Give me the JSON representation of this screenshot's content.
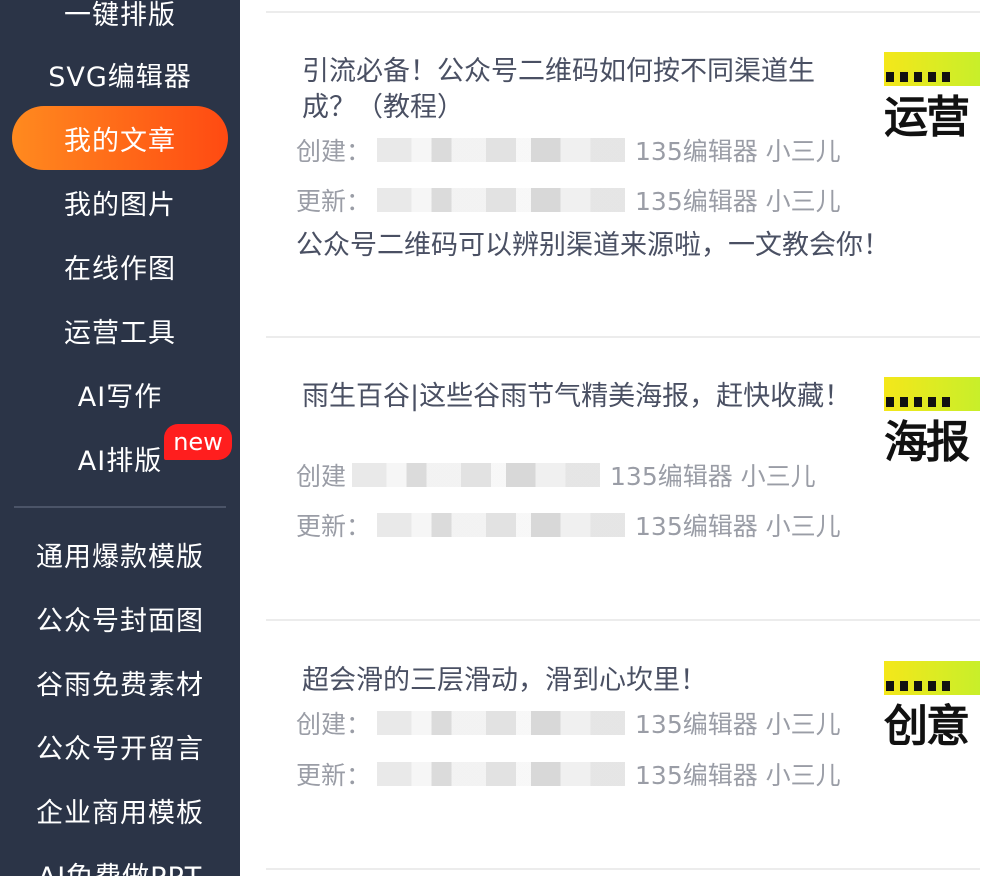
{
  "sidebar": {
    "items": [
      {
        "label": "一键排版"
      },
      {
        "label": "SVG编辑器"
      },
      {
        "label": "我的文章"
      },
      {
        "label": "我的图片"
      },
      {
        "label": "在线作图"
      },
      {
        "label": "运营工具"
      },
      {
        "label": "AI写作"
      },
      {
        "label": "AI排版",
        "badge": "new"
      }
    ],
    "templates": [
      {
        "label": "通用爆款模版"
      },
      {
        "label": "公众号封面图"
      },
      {
        "label": "谷雨免费素材"
      },
      {
        "label": "公众号开留言"
      },
      {
        "label": "企业商用模板"
      },
      {
        "label": "AI免费做PPT"
      }
    ],
    "active_item": "我的文章",
    "accent_gradient": [
      "#ff8a1f",
      "#ff4a12"
    ],
    "background": "#2b3447"
  },
  "articles": [
    {
      "title": "引流必备！公众号二维码如何按不同渠道生成？（教程）",
      "created_label": "创建：",
      "updated_label": "更新：",
      "created_author": "135编辑器 小三儿",
      "updated_author": "135编辑器 小三儿",
      "summary": "公众号二维码可以辨别渠道来源啦，一文教会你！",
      "thumb_text": "运营"
    },
    {
      "title": "雨生百谷|这些谷雨节气精美海报，赶快收藏！",
      "created_label": "创建",
      "updated_label": "更新：",
      "created_author": "135编辑器 小三儿",
      "updated_author": "135编辑器 小三儿",
      "summary": "",
      "thumb_text": "海报"
    },
    {
      "title": "超会滑的三层滑动，滑到心坎里！",
      "created_label": "创建：",
      "updated_label": "更新：",
      "created_author": "135编辑器 小三儿",
      "updated_author": "135编辑器 小三儿",
      "summary": "",
      "thumb_text": "创意"
    }
  ]
}
